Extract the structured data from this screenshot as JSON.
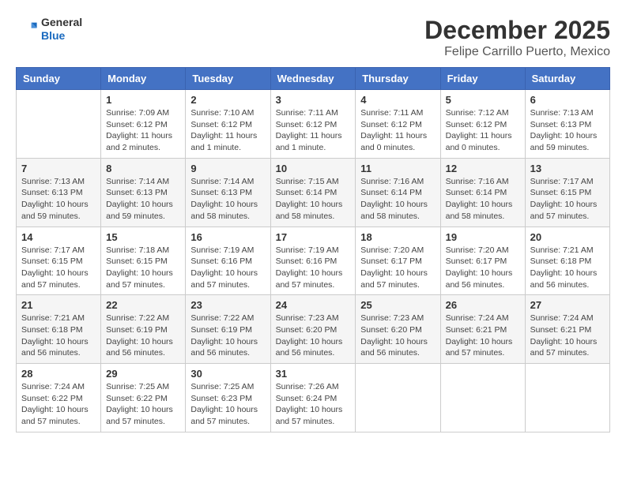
{
  "logo": {
    "general": "General",
    "blue": "Blue"
  },
  "title": "December 2025",
  "subtitle": "Felipe Carrillo Puerto, Mexico",
  "days_of_week": [
    "Sunday",
    "Monday",
    "Tuesday",
    "Wednesday",
    "Thursday",
    "Friday",
    "Saturday"
  ],
  "weeks": [
    [
      {
        "day": "",
        "info": ""
      },
      {
        "day": "1",
        "info": "Sunrise: 7:09 AM\nSunset: 6:12 PM\nDaylight: 11 hours\nand 2 minutes."
      },
      {
        "day": "2",
        "info": "Sunrise: 7:10 AM\nSunset: 6:12 PM\nDaylight: 11 hours\nand 1 minute."
      },
      {
        "day": "3",
        "info": "Sunrise: 7:11 AM\nSunset: 6:12 PM\nDaylight: 11 hours\nand 1 minute."
      },
      {
        "day": "4",
        "info": "Sunrise: 7:11 AM\nSunset: 6:12 PM\nDaylight: 11 hours\nand 0 minutes."
      },
      {
        "day": "5",
        "info": "Sunrise: 7:12 AM\nSunset: 6:12 PM\nDaylight: 11 hours\nand 0 minutes."
      },
      {
        "day": "6",
        "info": "Sunrise: 7:13 AM\nSunset: 6:13 PM\nDaylight: 10 hours\nand 59 minutes."
      }
    ],
    [
      {
        "day": "7",
        "info": "Sunrise: 7:13 AM\nSunset: 6:13 PM\nDaylight: 10 hours\nand 59 minutes."
      },
      {
        "day": "8",
        "info": "Sunrise: 7:14 AM\nSunset: 6:13 PM\nDaylight: 10 hours\nand 59 minutes."
      },
      {
        "day": "9",
        "info": "Sunrise: 7:14 AM\nSunset: 6:13 PM\nDaylight: 10 hours\nand 58 minutes."
      },
      {
        "day": "10",
        "info": "Sunrise: 7:15 AM\nSunset: 6:14 PM\nDaylight: 10 hours\nand 58 minutes."
      },
      {
        "day": "11",
        "info": "Sunrise: 7:16 AM\nSunset: 6:14 PM\nDaylight: 10 hours\nand 58 minutes."
      },
      {
        "day": "12",
        "info": "Sunrise: 7:16 AM\nSunset: 6:14 PM\nDaylight: 10 hours\nand 58 minutes."
      },
      {
        "day": "13",
        "info": "Sunrise: 7:17 AM\nSunset: 6:15 PM\nDaylight: 10 hours\nand 57 minutes."
      }
    ],
    [
      {
        "day": "14",
        "info": "Sunrise: 7:17 AM\nSunset: 6:15 PM\nDaylight: 10 hours\nand 57 minutes."
      },
      {
        "day": "15",
        "info": "Sunrise: 7:18 AM\nSunset: 6:15 PM\nDaylight: 10 hours\nand 57 minutes."
      },
      {
        "day": "16",
        "info": "Sunrise: 7:19 AM\nSunset: 6:16 PM\nDaylight: 10 hours\nand 57 minutes."
      },
      {
        "day": "17",
        "info": "Sunrise: 7:19 AM\nSunset: 6:16 PM\nDaylight: 10 hours\nand 57 minutes."
      },
      {
        "day": "18",
        "info": "Sunrise: 7:20 AM\nSunset: 6:17 PM\nDaylight: 10 hours\nand 57 minutes."
      },
      {
        "day": "19",
        "info": "Sunrise: 7:20 AM\nSunset: 6:17 PM\nDaylight: 10 hours\nand 56 minutes."
      },
      {
        "day": "20",
        "info": "Sunrise: 7:21 AM\nSunset: 6:18 PM\nDaylight: 10 hours\nand 56 minutes."
      }
    ],
    [
      {
        "day": "21",
        "info": "Sunrise: 7:21 AM\nSunset: 6:18 PM\nDaylight: 10 hours\nand 56 minutes."
      },
      {
        "day": "22",
        "info": "Sunrise: 7:22 AM\nSunset: 6:19 PM\nDaylight: 10 hours\nand 56 minutes."
      },
      {
        "day": "23",
        "info": "Sunrise: 7:22 AM\nSunset: 6:19 PM\nDaylight: 10 hours\nand 56 minutes."
      },
      {
        "day": "24",
        "info": "Sunrise: 7:23 AM\nSunset: 6:20 PM\nDaylight: 10 hours\nand 56 minutes."
      },
      {
        "day": "25",
        "info": "Sunrise: 7:23 AM\nSunset: 6:20 PM\nDaylight: 10 hours\nand 56 minutes."
      },
      {
        "day": "26",
        "info": "Sunrise: 7:24 AM\nSunset: 6:21 PM\nDaylight: 10 hours\nand 57 minutes."
      },
      {
        "day": "27",
        "info": "Sunrise: 7:24 AM\nSunset: 6:21 PM\nDaylight: 10 hours\nand 57 minutes."
      }
    ],
    [
      {
        "day": "28",
        "info": "Sunrise: 7:24 AM\nSunset: 6:22 PM\nDaylight: 10 hours\nand 57 minutes."
      },
      {
        "day": "29",
        "info": "Sunrise: 7:25 AM\nSunset: 6:22 PM\nDaylight: 10 hours\nand 57 minutes."
      },
      {
        "day": "30",
        "info": "Sunrise: 7:25 AM\nSunset: 6:23 PM\nDaylight: 10 hours\nand 57 minutes."
      },
      {
        "day": "31",
        "info": "Sunrise: 7:26 AM\nSunset: 6:24 PM\nDaylight: 10 hours\nand 57 minutes."
      },
      {
        "day": "",
        "info": ""
      },
      {
        "day": "",
        "info": ""
      },
      {
        "day": "",
        "info": ""
      }
    ]
  ]
}
